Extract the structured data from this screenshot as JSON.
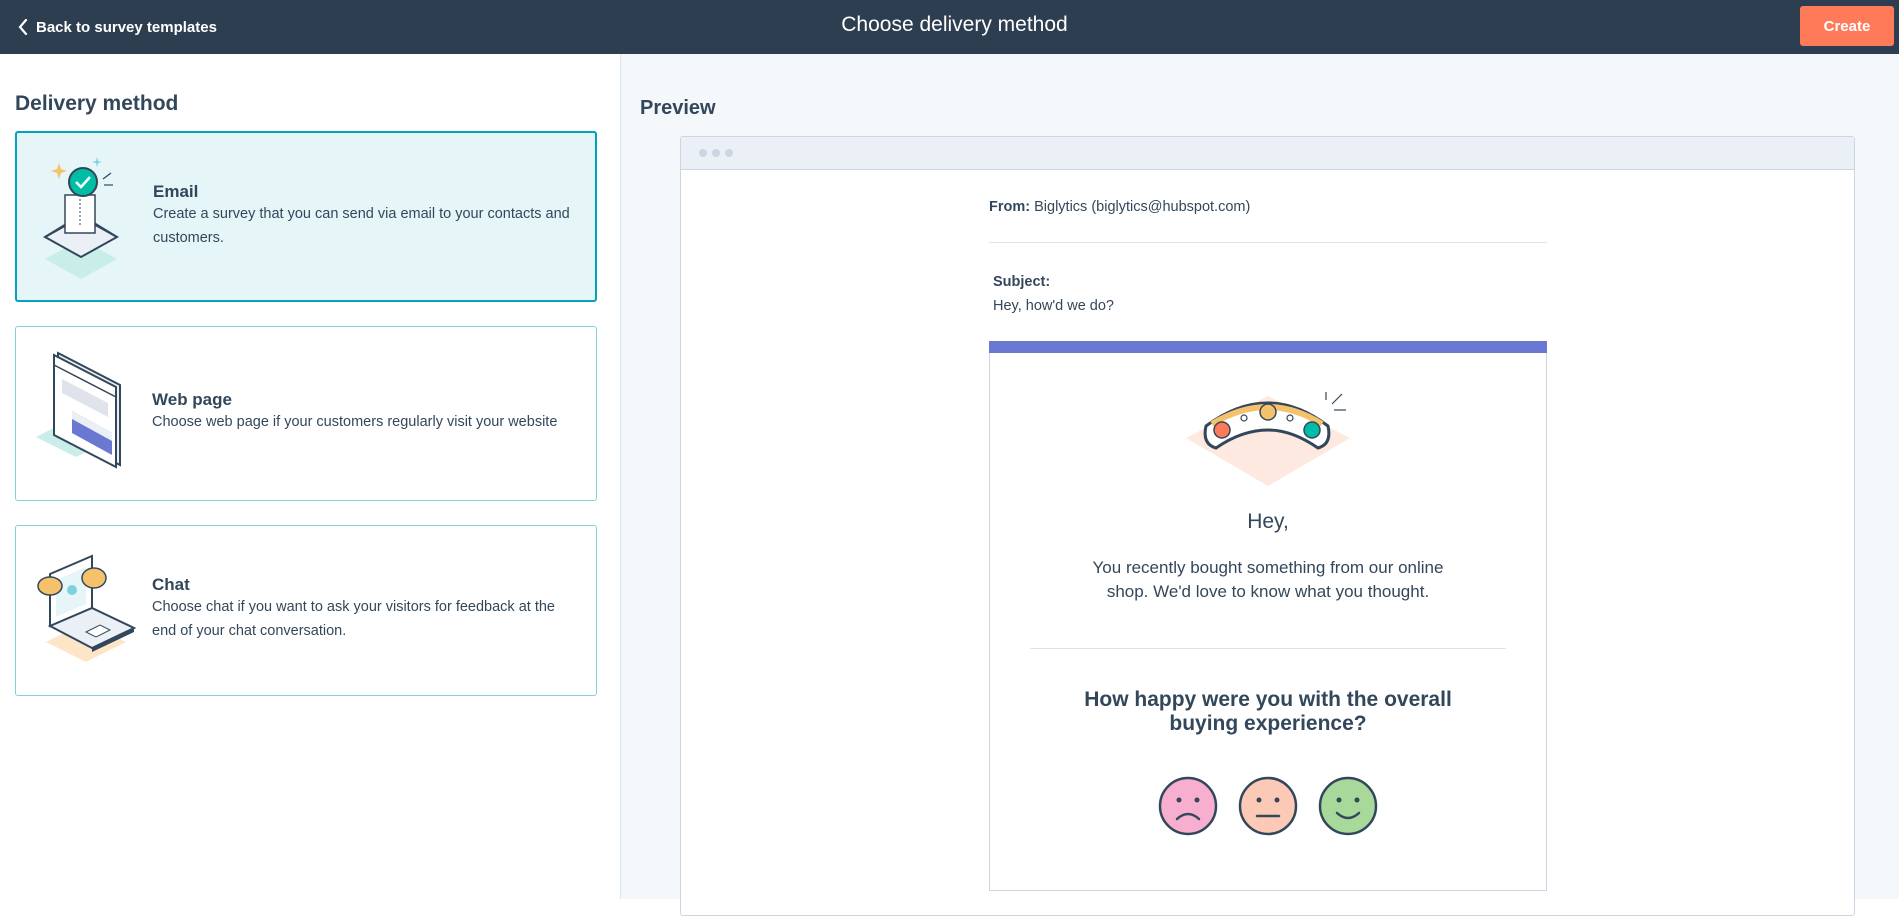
{
  "header": {
    "back_label": "Back to survey templates",
    "title": "Choose delivery method",
    "create_label": "Create"
  },
  "left": {
    "title": "Delivery method",
    "options": [
      {
        "title": "Email",
        "description": "Create a survey that you can send via email to your contacts and customers.",
        "icon": "envelope-badge-icon",
        "selected": true
      },
      {
        "title": "Web page",
        "description": "Choose web page if your customers regularly visit your website",
        "icon": "web-page-icon",
        "selected": false
      },
      {
        "title": "Chat",
        "description": "Choose chat if you want to ask your visitors for feedback at the end of your chat conversation.",
        "icon": "chat-laptop-icon",
        "selected": false
      }
    ]
  },
  "preview": {
    "title": "Preview",
    "from_label": "From:",
    "from_value": "Biglytics (biglytics@hubspot.com)",
    "subject_label": "Subject:",
    "subject_value": "Hey, how'd we do?",
    "greeting": "Hey,",
    "intro": "You recently bought something from our online shop. We'd love to know what you thought.",
    "question": "How happy were you with the overall buying experience?",
    "faces": [
      "sad-face-icon",
      "neutral-face-icon",
      "happy-face-icon"
    ]
  },
  "colors": {
    "header_bg": "#2d3e50",
    "accent": "#ff7a59",
    "selected_border": "#00a4bd",
    "email_bar": "#6a78d1"
  }
}
